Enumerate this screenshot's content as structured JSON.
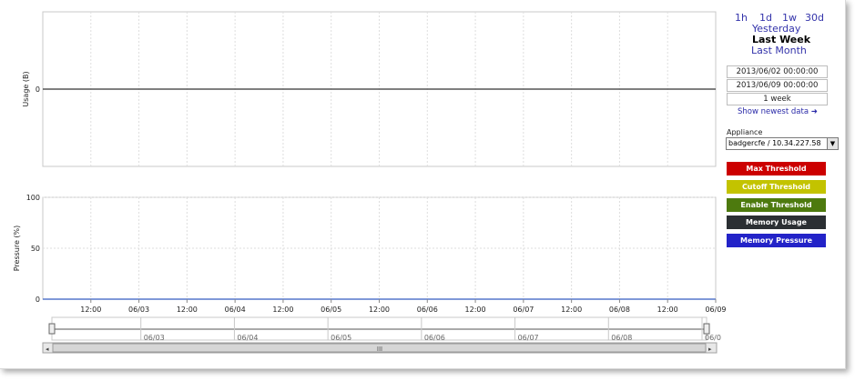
{
  "time_links": [
    "1h",
    "1d",
    "1w",
    "30d"
  ],
  "range_links": {
    "yesterday": "Yesterday",
    "last_week": "Last Week",
    "last_month": "Last Month"
  },
  "date_range": {
    "start": "2013/06/02 00:00:00",
    "end": "2013/06/09 00:00:00",
    "duration": "1 week"
  },
  "show_newest_label": "Show newest data ➜",
  "appliance": {
    "label": "Appliance",
    "value": "badgercfe / 10.34.227.58"
  },
  "legend": [
    {
      "label": "Max Threshold",
      "color": "#cc0000"
    },
    {
      "label": "Cutoff Threshold",
      "color": "#c3c300"
    },
    {
      "label": "Enable Threshold",
      "color": "#4d7a0e"
    },
    {
      "label": "Memory Usage",
      "color": "#2b2f33"
    },
    {
      "label": "Memory Pressure",
      "color": "#2323c8"
    }
  ],
  "scrollbar": {
    "grip": "III"
  },
  "chart_data": [
    {
      "type": "line",
      "ylabel": "Usage (B)",
      "yticks": [
        "0"
      ],
      "grid": true,
      "x": [
        "2013/06/02 00:00:00",
        "2013/06/09 00:00:00"
      ],
      "series": [
        {
          "values": [
            0,
            0
          ],
          "color": "#555555"
        }
      ]
    },
    {
      "type": "line",
      "ylabel": "Pressure (%)",
      "ylim": [
        0,
        100
      ],
      "yticks": [
        "0",
        "50",
        "100"
      ],
      "xticks": [
        "12:00",
        "06/03",
        "12:00",
        "06/04",
        "12:00",
        "06/05",
        "12:00",
        "06/06",
        "12:00",
        "06/07",
        "12:00",
        "06/08",
        "12:00",
        "06/09"
      ],
      "grid": true,
      "x": [
        "2013/06/02 00:00:00",
        "2013/06/09 00:00:00"
      ],
      "series": [
        {
          "values": [
            0,
            0
          ],
          "color": "#5577cc"
        }
      ]
    }
  ],
  "navigator": {
    "labels": [
      "06/03",
      "06/04",
      "06/05",
      "06/06",
      "06/07",
      "06/08",
      "06/0"
    ]
  }
}
